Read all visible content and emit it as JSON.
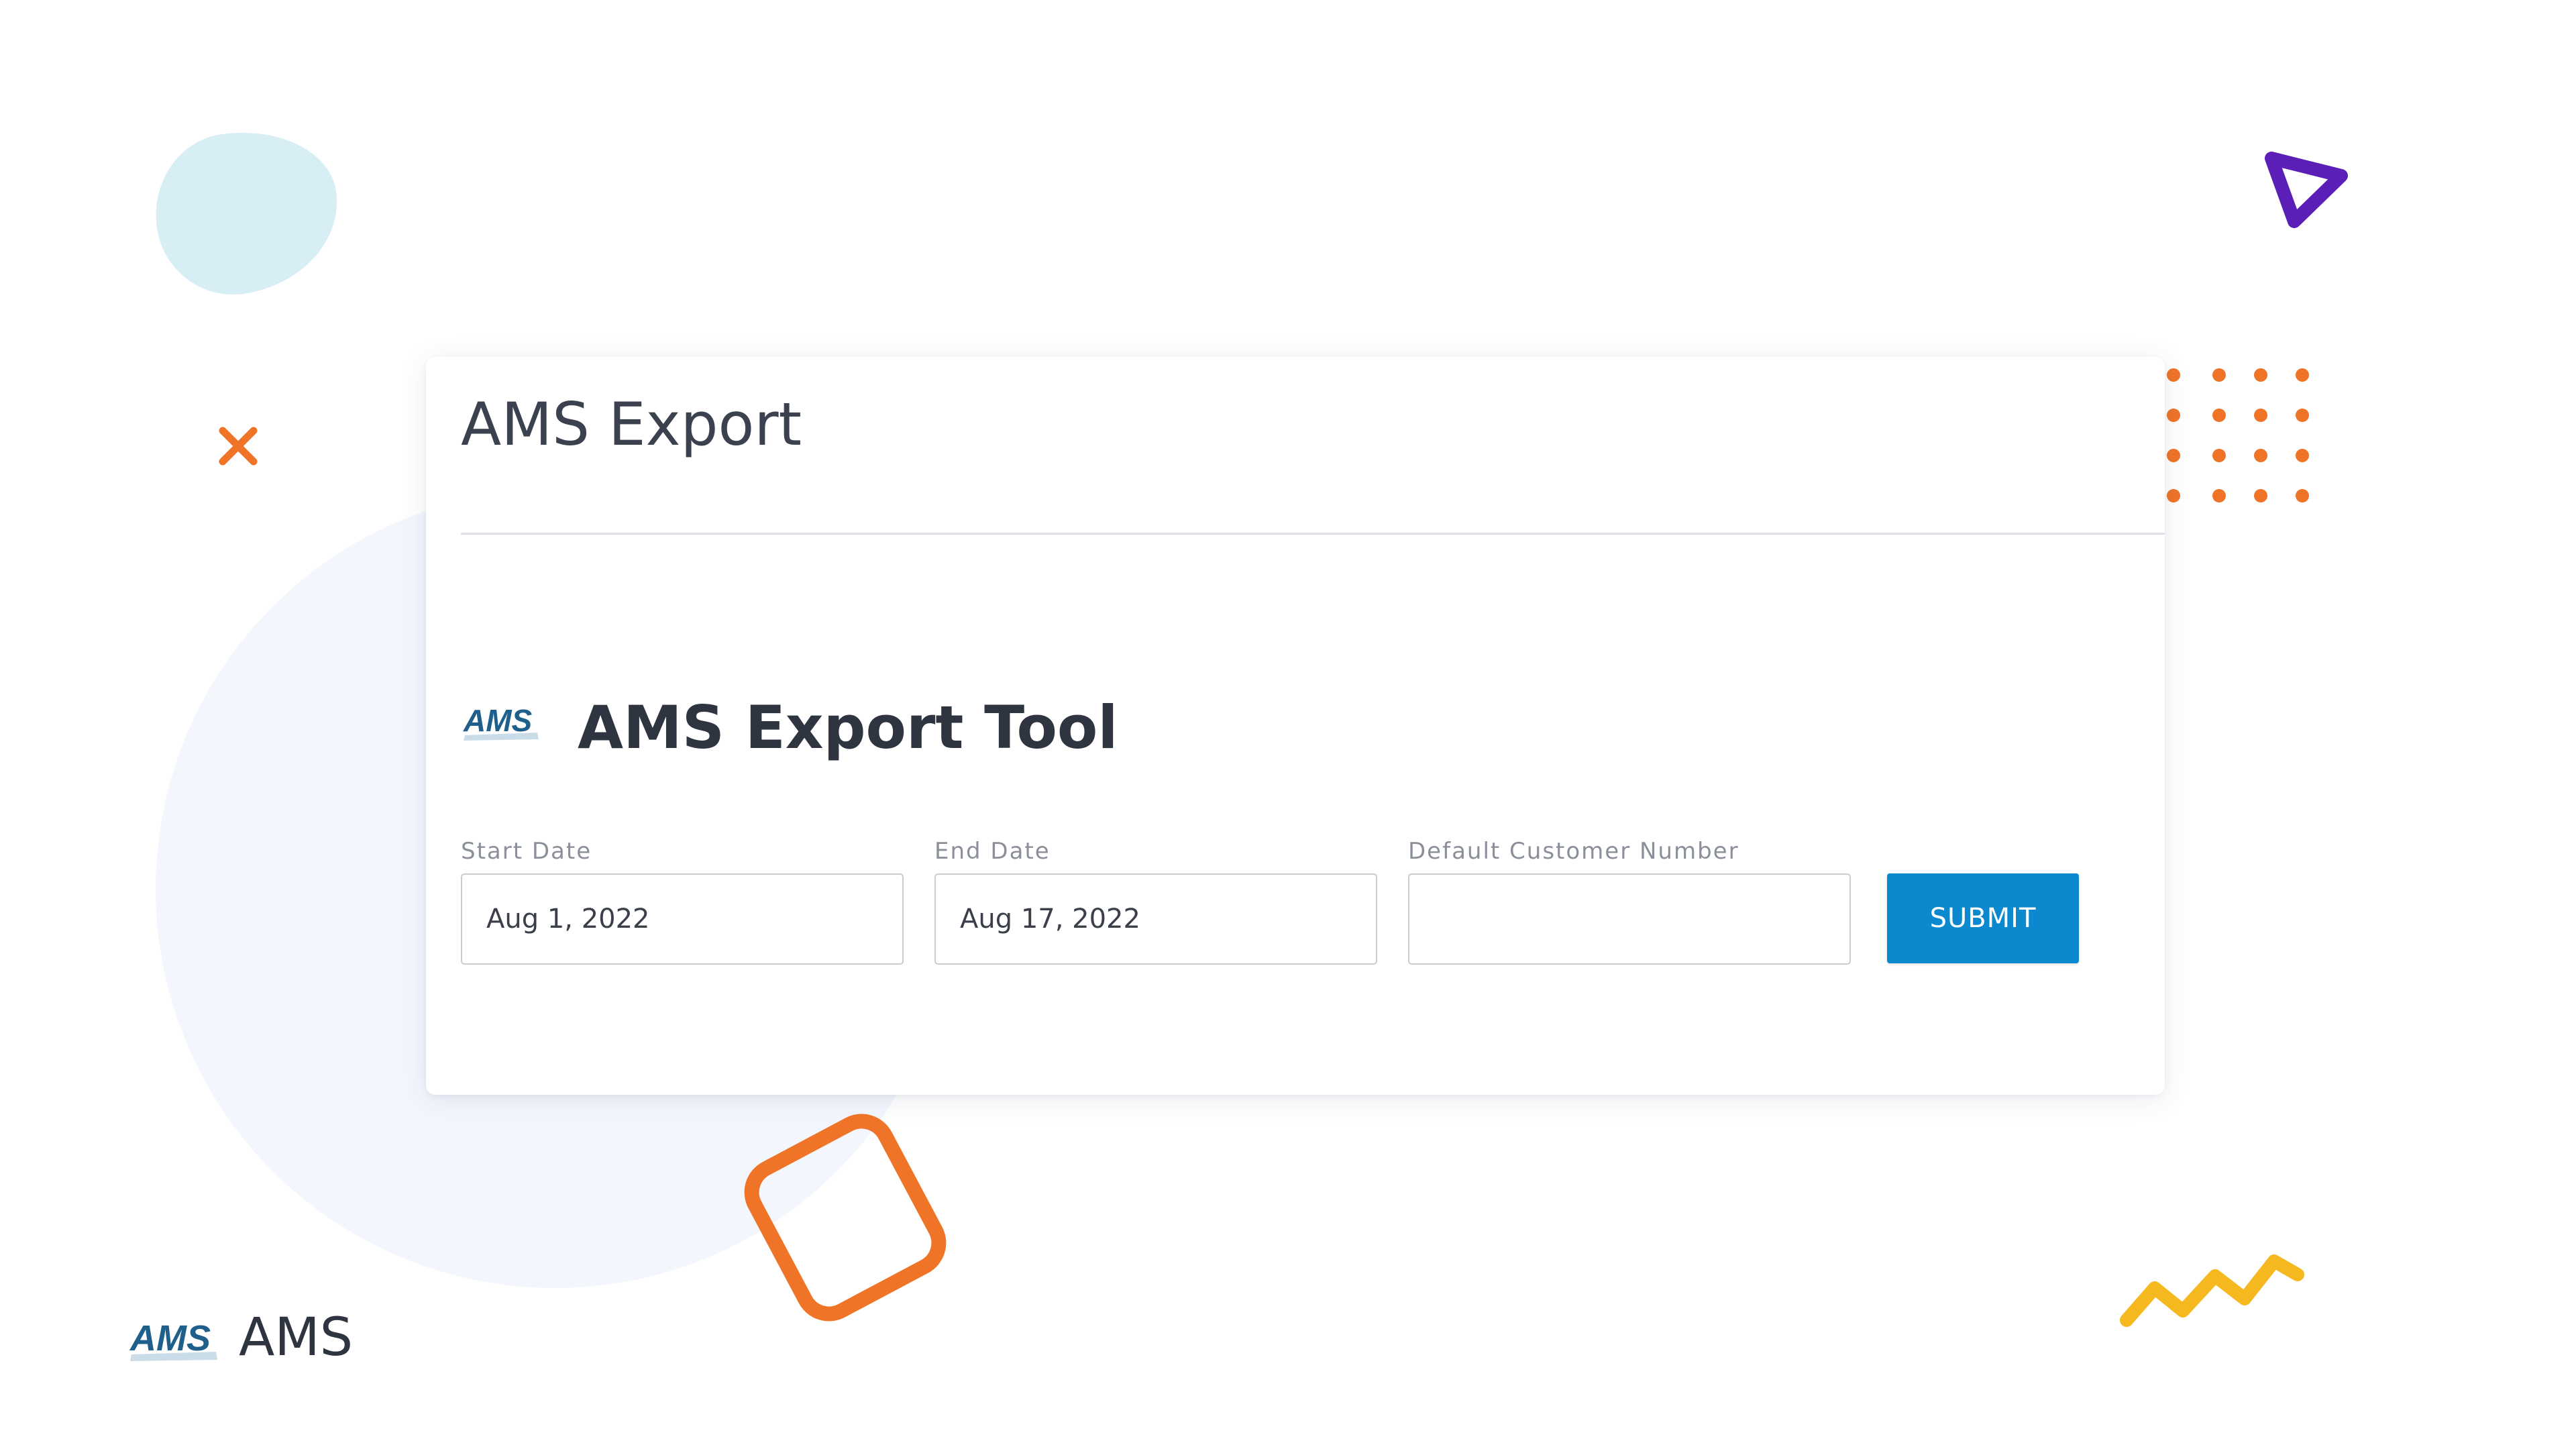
{
  "card": {
    "title": "AMS Export"
  },
  "tool": {
    "logo_text": "AMS",
    "heading": "AMS Export Tool"
  },
  "form": {
    "start_date": {
      "label": "Start Date",
      "value": "Aug 1, 2022"
    },
    "end_date": {
      "label": "End Date",
      "value": "Aug 17, 2022"
    },
    "customer_number": {
      "label": "Default Customer Number",
      "value": ""
    },
    "submit_label": "SUBMIT"
  },
  "footer": {
    "logo_text": "AMS",
    "brand_name": "AMS"
  },
  "colors": {
    "accent": "#0b88ce",
    "orange": "#f07428",
    "purple": "#5b1fb8",
    "yellow": "#f5b91f",
    "blob": "#d6eef4",
    "circle": "#f3f6fd",
    "logo_blue": "#1f5f8b"
  },
  "icons": {
    "decor_x": "x-mark-icon",
    "decor_triangle": "play-triangle-icon",
    "decor_dots": "dot-grid-icon",
    "decor_square": "rounded-square-icon",
    "decor_zigzag": "zigzag-icon"
  }
}
